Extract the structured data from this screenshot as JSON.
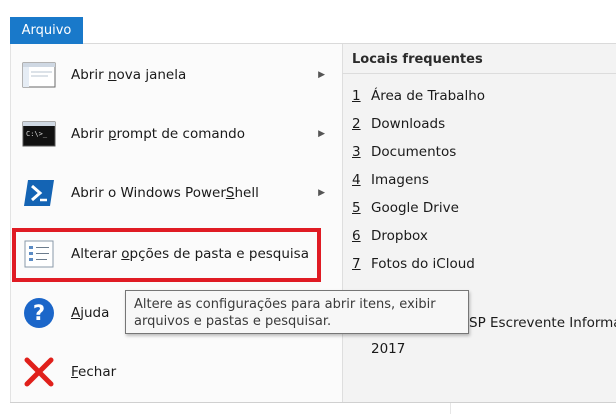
{
  "tab": {
    "label": "Arquivo"
  },
  "menu": [
    {
      "pre": "Abrir ",
      "ul": "n",
      "post": "ova janela",
      "icon": "new-window-icon",
      "submenu": true
    },
    {
      "pre": "Abrir ",
      "ul": "p",
      "post": "rompt de comando",
      "icon": "command-prompt-icon",
      "submenu": true
    },
    {
      "pre": "Abrir o Windows Power",
      "ul": "S",
      "post": "hell",
      "icon": "powershell-icon",
      "submenu": true
    },
    {
      "pre": "Alterar ",
      "ul": "o",
      "post": "pções de pasta e pesquisa",
      "icon": "folder-options-icon",
      "submenu": false
    },
    {
      "pre": "",
      "ul": "A",
      "post": "juda",
      "icon": "help-icon",
      "submenu": false
    },
    {
      "pre": "",
      "ul": "F",
      "post": "echar",
      "icon": "close-icon",
      "submenu": false
    }
  ],
  "recent": {
    "header": "Locais frequentes",
    "items": [
      {
        "num": "1",
        "label": "Área de Trabalho"
      },
      {
        "num": "2",
        "label": "Downloads"
      },
      {
        "num": "3",
        "label": "Documentos"
      },
      {
        "num": "4",
        "label": "Imagens"
      },
      {
        "num": "5",
        "label": "Google Drive"
      },
      {
        "num": "6",
        "label": "Dropbox"
      },
      {
        "num": "7",
        "label": "Fotos do iCloud"
      }
    ],
    "partial_label": "SP Escrevente Informa",
    "item_year": "2017"
  },
  "tooltip": {
    "line1": "Altere as configurações para abrir itens, exibir",
    "line2": "arquivos e pastas e pesquisar."
  },
  "colors": {
    "accent": "#1979ca",
    "highlight": "#e01b24",
    "powershell": "#1464b4",
    "help": "#1b66c9",
    "close": "#e0201b"
  }
}
